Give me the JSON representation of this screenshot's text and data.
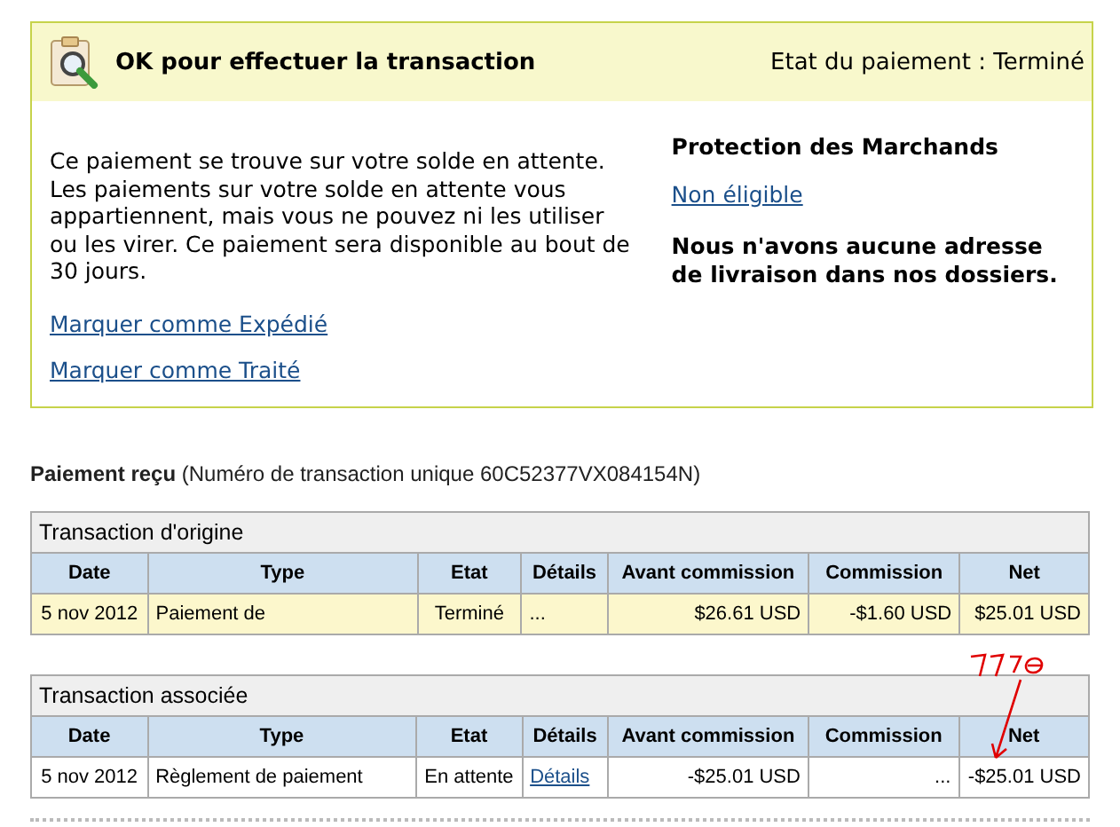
{
  "status_panel": {
    "title": "OK pour effectuer la transaction",
    "status": "Etat du paiement : Terminé",
    "message": "Ce paiement se trouve sur votre solde en attente. Les paiements sur votre solde en attente vous appartiennent, mais vous ne pouvez ni les utiliser ou les virer. Ce paiement sera disponible au bout de 30 jours.",
    "actions": [
      "Marquer comme Expédié",
      "Marquer comme Traité"
    ],
    "protection": {
      "heading": "Protection des Marchands",
      "link": "Non éligible",
      "note": "Nous n'avons aucune adresse de livraison dans nos dossiers."
    }
  },
  "payment": {
    "label": "Paiement reçu",
    "detail": "(Numéro de transaction unique 60C52377VX084154N)"
  },
  "tables": [
    {
      "caption": "Transaction d'origine",
      "columns": [
        "Date",
        "Type",
        "Etat",
        "Détails",
        "Avant commission",
        "Commission",
        "Net"
      ],
      "annotated": false,
      "rows": [
        {
          "highlighted": true,
          "date": "5 nov 2012",
          "type": "Paiement de",
          "state": "Terminé",
          "details": {
            "text": "...",
            "link": false
          },
          "gross": "$26.61 USD",
          "fee": "-$1.60 USD",
          "net": "$25.01 USD"
        }
      ]
    },
    {
      "caption": "Transaction associée",
      "columns": [
        "Date",
        "Type",
        "Etat",
        "Détails",
        "Avant commission",
        "Commission",
        "Net"
      ],
      "annotated": true,
      "rows": [
        {
          "highlighted": false,
          "date": "5 nov 2012",
          "type": "Règlement de paiement",
          "state": "En attente",
          "details": {
            "text": "Détails",
            "link": true
          },
          "gross": "-$25.01 USD",
          "fee": "...",
          "net": "-$25.01 USD"
        }
      ]
    }
  ]
}
